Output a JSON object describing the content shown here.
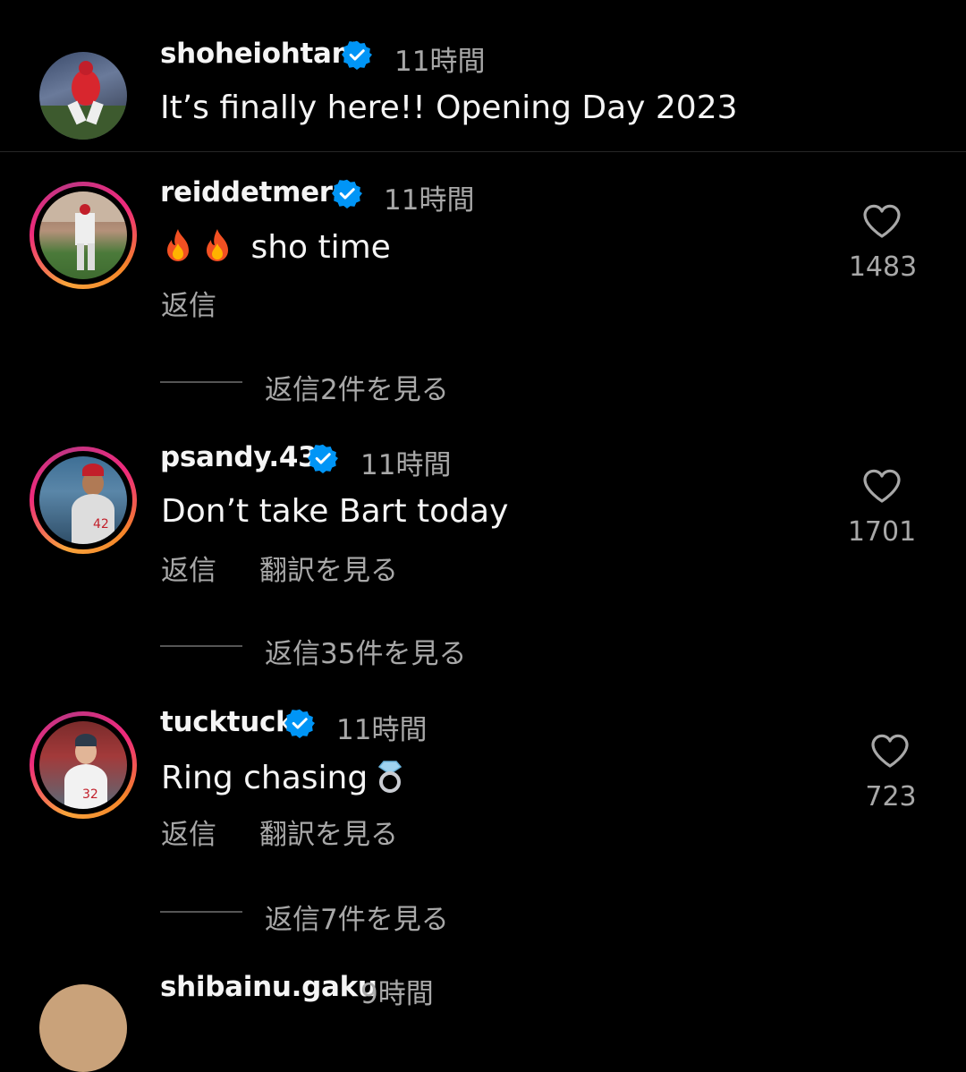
{
  "caption": {
    "username": "shoheiohtani",
    "time": "11時間",
    "text": "It’s finally here!! Opening Day 2023"
  },
  "comments": [
    {
      "username": "reiddetmers",
      "time": "11時間",
      "text": "sho time",
      "emoji": [
        "fire",
        "fire"
      ],
      "reply_label": "返信",
      "likes": "1483",
      "view_replies": "返信2件を見る"
    },
    {
      "username": "psandy.43",
      "time": "11時間",
      "text": "Don’t take Bart today",
      "reply_label": "返信",
      "translate_label": "翻訳を見る",
      "likes": "1701",
      "view_replies": "返信35件を見る"
    },
    {
      "username": "tucktuck",
      "time": "11時間",
      "text": "Ring chasing",
      "emoji": [
        "ring"
      ],
      "reply_label": "返信",
      "translate_label": "翻訳を見る",
      "likes": "723",
      "view_replies": "返信7件を見る"
    },
    {
      "username": "shibainu.gaku",
      "time": "9時間"
    }
  ],
  "colors": {
    "background": "#000000",
    "verified": "#0095f6",
    "secondary_text": "#a8a8a8"
  },
  "icons": [
    "verified-badge-icon",
    "heart-icon",
    "fire-emoji",
    "ring-emoji"
  ]
}
